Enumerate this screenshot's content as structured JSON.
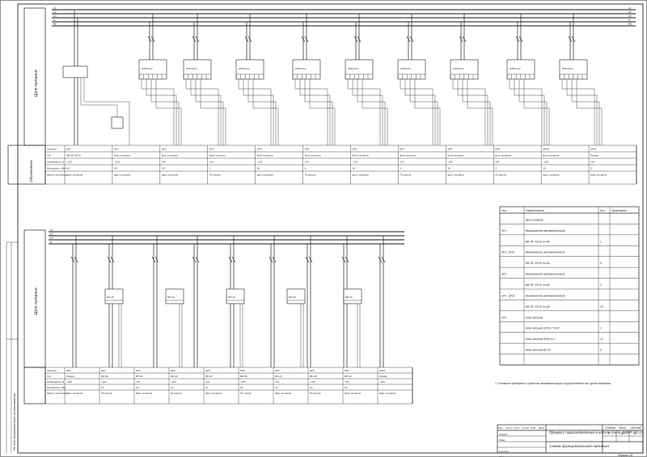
{
  "buses": {
    "top": [
      "L1",
      "L2",
      "L3",
      "N",
      "PE"
    ],
    "bottom": [
      "L1",
      "L2",
      "L3",
      "N"
    ]
  },
  "vertical_labels": {
    "top_panel": "Щит питания",
    "bottom_panel": "Щит питания",
    "left_table": "Обозначение",
    "stamp_strip": "Не для коммерческого использования"
  },
  "top_diagram": {
    "module_label": "КПМ-24-2",
    "tags": [
      "QF1",
      "GF1",
      "QF2",
      "QF3",
      "QF4",
      "QF5",
      "QF6",
      "QF7",
      "QF8",
      "QF9",
      "QF10",
      "QF11"
    ]
  },
  "top_table": {
    "row_labels": [
      "Позиция",
      "Тип",
      "Напряжение, В",
      "Мощность, кВт",
      "Место установки"
    ],
    "columns": [
      [
        "QF1",
        "АВ 1Ф 220 В",
        "~220",
        "4,0",
        "Щит питания"
      ],
      [
        "GF1",
        "Блок питания",
        "~220",
        "4,0",
        "Щит питания"
      ],
      [
        "QF2",
        "Блок питания",
        "=24",
        "0,5",
        "Щит питания"
      ],
      [
        "QF3",
        "Блок питания",
        "=24",
        "2",
        "По месту"
      ],
      [
        "QF4",
        "Блок питания",
        "~220",
        "16",
        "Щит питания"
      ],
      [
        "QF5",
        "Блок питания",
        "=24",
        "3",
        "По месту"
      ],
      [
        "QF6",
        "Блок питания",
        "~220",
        "16",
        "Щит питания"
      ],
      [
        "QF7",
        "Блок питания",
        "=24",
        "3",
        "По месту"
      ],
      [
        "QF8",
        "Блок питания",
        "~220",
        "16",
        "Щит питания"
      ],
      [
        "QF9",
        "Блок питания",
        "=24",
        "3",
        "По месту"
      ],
      [
        "QF10",
        "Блок питания",
        "~220",
        "16",
        "Щит питания"
      ],
      [
        "QF11",
        "Резерв",
        "=24",
        "3",
        "Щит питания"
      ]
    ]
  },
  "bottom_diagram": {
    "module_label": "БП-10",
    "tags": [
      "SF1",
      "SF2",
      "SF3",
      "SF4",
      "SF5",
      "SF6"
    ]
  },
  "bottom_table": {
    "row_labels": [
      "Позиция",
      "Тип",
      "Напряжение, В",
      "Мощность, кВт",
      "Место установки"
    ],
    "columns": [
      [
        "SF1",
        "Резерв",
        "~220",
        "",
        "Щит питания"
      ],
      [
        "SF2",
        "ВА 1Ф",
        "~220",
        "10",
        "По месту"
      ],
      [
        "SF3",
        "БП-10",
        "=24",
        "10",
        "Щит питания"
      ],
      [
        "SF4",
        "ВА 1Ф",
        "~220",
        "10",
        "По месту"
      ],
      [
        "SF5",
        "БП-10",
        "=24",
        "10",
        "Щит питания"
      ],
      [
        "SF6",
        "ВА 1Ф",
        "~220",
        "10",
        "По месту"
      ],
      [
        "SF7",
        "БП-10",
        "=24",
        "10",
        "Щит питания"
      ],
      [
        "SF8",
        "ВА 1Ф",
        "~220",
        "10",
        "По месту"
      ],
      [
        "SF9",
        "БП-10",
        "=24",
        "10",
        "Щит питания"
      ],
      [
        "SF10",
        "Резерв",
        "~220",
        "",
        "Щит питания"
      ]
    ]
  },
  "spec_table": {
    "headers": [
      "Поз.",
      "Наименование",
      "Кол.",
      "Примечание"
    ],
    "rows": [
      [
        "",
        "Щит питания",
        "",
        ""
      ],
      [
        "SF1",
        "Выключатель автоматический",
        "",
        ""
      ],
      [
        "",
        "ВА 1Ф, 220 В, Iн=4А",
        "1",
        ""
      ],
      [
        "SF2...SF10",
        "Выключатель автоматический",
        "",
        ""
      ],
      [
        "",
        "ВА 1Ф, 220 В, Iн=2А",
        "9",
        ""
      ],
      [
        "QF1",
        "Выключатель автоматический",
        "",
        ""
      ],
      [
        "",
        "ВА 1Ф, 220 В, Iн=6А",
        "1",
        ""
      ],
      [
        "QF2...QF11",
        "Выключатель автоматический",
        "",
        ""
      ],
      [
        "",
        "ВА 1Ф, 220 В, Iн=2А",
        "10",
        ""
      ],
      [
        "GF1",
        "Блок питания",
        "",
        ""
      ],
      [
        "",
        "Блок питания 220 В / =24 В",
        "1",
        ""
      ],
      [
        "",
        "Блок питания КПМ-24-2",
        "10",
        ""
      ],
      [
        "",
        "Блок питания БП-10",
        "5",
        ""
      ],
      [
        "",
        "",
        "",
        ""
      ]
    ],
    "note": "1. Питание приборов и средств автоматизации осуществлено от щита питания."
  },
  "title_block": {
    "project": "Процесс пароотделения в котле типа ДКВР-20-13",
    "doc_title": "Схема принципиальная питания",
    "stage_label": "Стадия",
    "stage": "У",
    "sheet_label": "Лист",
    "sheet": "1",
    "sheets_label": "Листов",
    "sheets": "1",
    "roles": [
      "Изм.",
      "Кол.уч",
      "Лист",
      "№ док.",
      "Подп.",
      "Дата"
    ],
    "people": [
      "Разраб.",
      "Пров.",
      "",
      "Н.контр.",
      "Утв."
    ],
    "format": "Формат А1"
  }
}
